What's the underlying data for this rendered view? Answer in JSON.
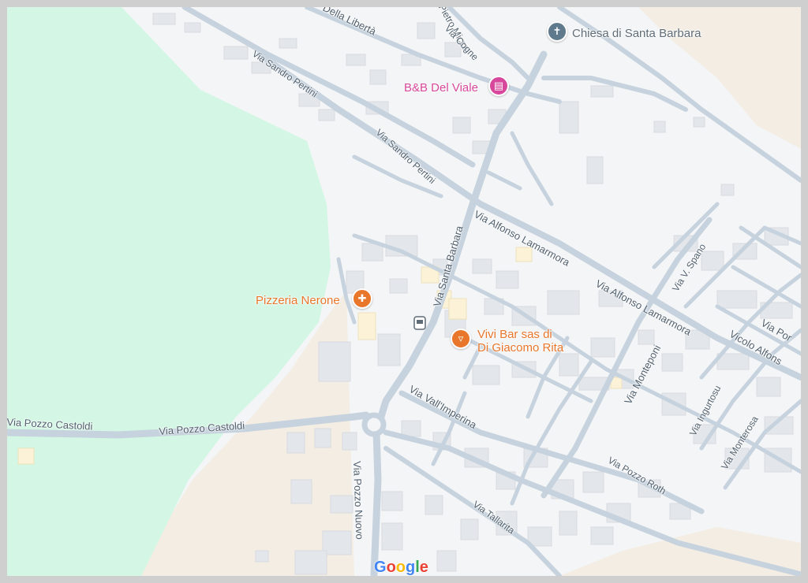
{
  "map": {
    "pois": {
      "church": {
        "name": "Chiesa di Santa Barbara",
        "icon": "church-cross-icon",
        "color": "#5f7a8c"
      },
      "bnb": {
        "name": "B&B Del Viale",
        "icon": "bed-icon",
        "color": "#d7479b"
      },
      "pizzeria": {
        "name": "Pizzeria Nerone",
        "icon": "fork-knife-icon",
        "color": "#e8762b"
      },
      "bar_line1": "Vivi Bar sas di",
      "bar_line2": "Di Giacomo Rita",
      "bar": {
        "icon": "cocktail-glass-icon",
        "color": "#e8762b"
      }
    },
    "streets": {
      "della_liberta": "Della Libertà",
      "micca": "Pietro Micca",
      "cogne": "Via Cogne",
      "pertini_a": "Via Sandro Pertini",
      "pertini_b": "Via Sandro Pertini",
      "santa_barbara": "Via Santa Barbara",
      "lamarmora_a": "Via Alfonso Lamarmora",
      "lamarmora_b": "Via Alfonso Lamarmora",
      "spano": "Via V. Spano",
      "via_por": "Via Por",
      "vicolo_alfonso": "Vicolo Alfons",
      "monteponi": "Via Monteponi",
      "ingurtosu": "Via Ingurtosu",
      "monterosa": "Via Monterosa",
      "pozzo_roth": "Via Pozzo Roth",
      "vall_imperina": "Via Vall'Imperina",
      "tallarita": "Via Tallarita",
      "pozzo_nuovo": "Via Pozzo Nuovo",
      "castoldi_a": "Via Pozzo Castoldi",
      "castoldi_b": "Via Pozzo Castoldi"
    },
    "attribution": "Google",
    "colors": {
      "park": "#d3f7e4",
      "sand": "#f3ede3",
      "road": "#c6d2dd",
      "building": "#e3e6ea",
      "background": "#f4f5f7"
    }
  }
}
